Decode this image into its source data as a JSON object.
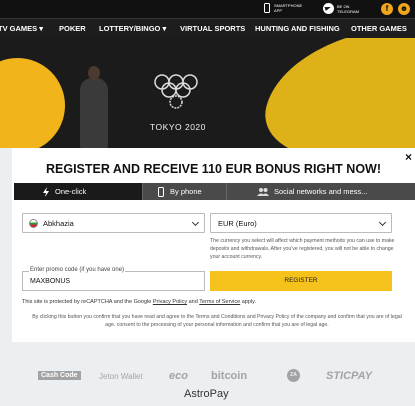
{
  "topbar": {
    "app_label_line1": "SMARTPHONE",
    "app_label_line2": "APP",
    "telegram_line1": "BE ON",
    "telegram_line2": "TELEGRAM",
    "social": [
      "f",
      "☻"
    ]
  },
  "nav": {
    "items": [
      "TV GAMES ▾",
      "POKER",
      "LOTTERY/BINGO ▾",
      "VIRTUAL SPORTS",
      "HUNTING AND FISHING",
      "OTHER GAMES"
    ]
  },
  "hero": {
    "olympic_text": "TOKYO 2020"
  },
  "modal": {
    "title": "REGISTER AND RECEIVE 110 EUR BONUS RIGHT NOW!",
    "close": "×",
    "tabs": [
      {
        "label": "One-click",
        "icon": "lightning-icon"
      },
      {
        "label": "By phone",
        "icon": "phone-icon"
      },
      {
        "label": "Social networks and mess...",
        "icon": "people-icon"
      }
    ],
    "country": "Abkhazia",
    "currency": "EUR (Euro)",
    "currency_note": "The currency you select will affect which payment methods you can use to make deposits and withdrawals. After you've registered, you will not be able to change your account currency.",
    "promo_label": "Enter promo code (if you have one)",
    "promo_value": "MAXBONUS",
    "register_label": "REGISTER",
    "captcha_text": "This site is protected by reCAPTCHA and the Google",
    "privacy_link": "Privacy Policy",
    "and_text": "and",
    "terms_link": "Terms of Service",
    "apply_text": "apply.",
    "consent": "By clicking this button you confirm that you have read and agree to the Terms and Conditions and Privacy Policy of the company and confirm that you are of legal age. consent to the processing of your personal information and confirm that you are of legal age."
  },
  "payments": [
    "Cash Code",
    "Jeton Wallet",
    "eco",
    "bitcoin",
    "ZA",
    "STICPAY",
    "AstroPay"
  ],
  "colors": {
    "accent": "#f4c21a",
    "dark": "#1d1d1d"
  }
}
